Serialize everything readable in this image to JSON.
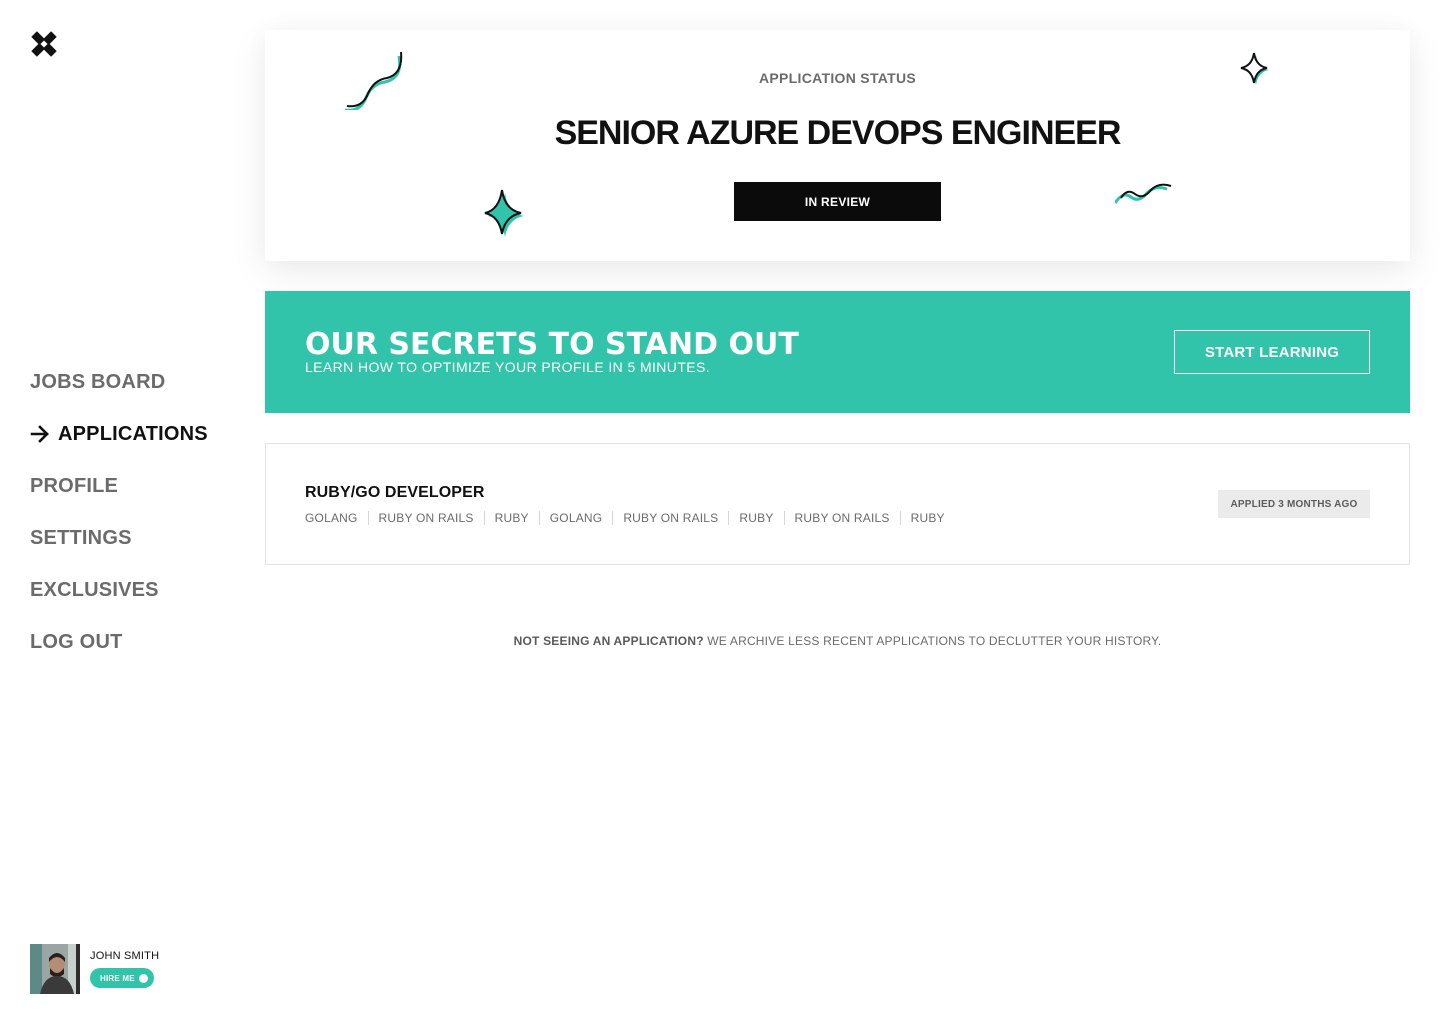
{
  "brand": {
    "logo": "x-logo-icon"
  },
  "sidebar": {
    "items": [
      {
        "label": "JOBS BOARD",
        "active": false
      },
      {
        "label": "APPLICATIONS",
        "active": true
      },
      {
        "label": "PROFILE",
        "active": false
      },
      {
        "label": "SETTINGS",
        "active": false
      },
      {
        "label": "EXCLUSIVES",
        "active": false
      },
      {
        "label": "LOG OUT",
        "active": false
      }
    ],
    "active_icon": "arrow-right-icon"
  },
  "user": {
    "name": "JOHN SMITH",
    "hire_label": "HIRE ME",
    "hire_enabled": true
  },
  "status_card": {
    "label": "APPLICATION STATUS",
    "title": "SENIOR AZURE DEVOPS ENGINEER",
    "status": "IN REVIEW"
  },
  "promo": {
    "title": "OUR SECRETS TO STAND OUT",
    "subtitle": "LEARN HOW TO OPTIMIZE YOUR PROFILE IN 5 MINUTES.",
    "button": "START LEARNING"
  },
  "application": {
    "title": "RUBY/GO DEVELOPER",
    "tags": [
      "GOLANG",
      "RUBY ON RAILS",
      "RUBY",
      "GOLANG",
      "RUBY ON RAILS",
      "RUBY",
      "RUBY ON RAILS",
      "RUBY"
    ],
    "applied": "APPLIED 3 MONTHS AGO"
  },
  "archive_note": {
    "bold": "NOT SEEING AN APPLICATION?",
    "text": " WE ARCHIVE LESS RECENT APPLICATIONS TO DECLUTTER YOUR HISTORY."
  },
  "colors": {
    "accent": "#31c4aa",
    "dark": "#0b0b0b",
    "muted": "#6b6b6b"
  }
}
